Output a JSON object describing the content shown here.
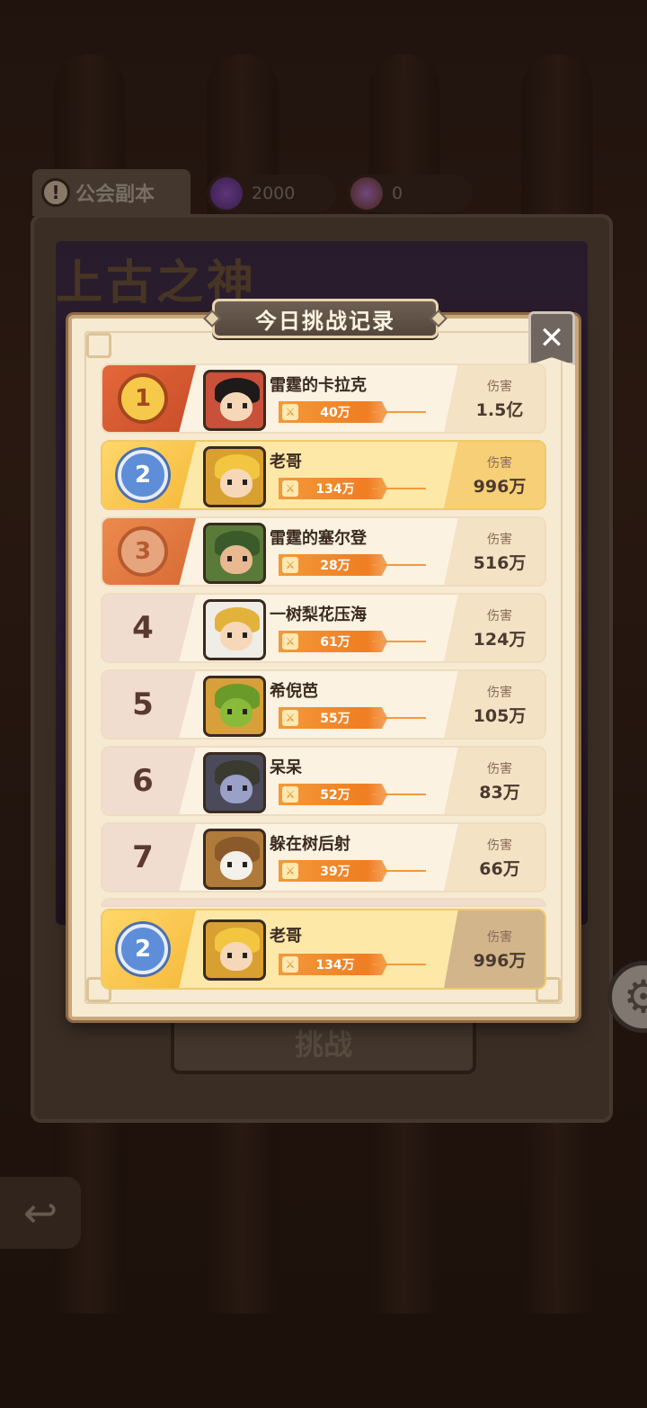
{
  "background": {
    "tab_label": "公会副本",
    "tab_icon": "!",
    "resources": [
      {
        "icon": "purple-gem-coin-icon",
        "value": "2000"
      },
      {
        "icon": "purple-orb-coin-icon",
        "value": "0"
      }
    ],
    "boss_title": "上古之神",
    "challenge_button": "挑战"
  },
  "dialog": {
    "title": "今日挑战记录",
    "close_symbol": "✕",
    "damage_label": "伤害",
    "entries": [
      {
        "rank": "1",
        "name": "雷霆的卡拉克",
        "power": "40万",
        "damage": "1.5亿"
      },
      {
        "rank": "2",
        "name": "老哥",
        "power": "134万",
        "damage": "996万"
      },
      {
        "rank": "3",
        "name": "雷霆的塞尔登",
        "power": "28万",
        "damage": "516万"
      },
      {
        "rank": "4",
        "name": "一树梨花压海",
        "power": "61万",
        "damage": "124万"
      },
      {
        "rank": "5",
        "name": "希倪芭",
        "power": "55万",
        "damage": "105万"
      },
      {
        "rank": "6",
        "name": "呆呆",
        "power": "52万",
        "damage": "83万"
      },
      {
        "rank": "7",
        "name": "躲在树后射",
        "power": "39万",
        "damage": "66万"
      }
    ],
    "my_entry": {
      "rank": "2",
      "name": "老哥",
      "power": "134万",
      "damage": "996万"
    }
  },
  "colors": {
    "rank1": "#e4683a",
    "rank2": "#f5b93a",
    "rank3": "#d86a34",
    "power_bar": "#f07d22",
    "panel_bg": "#f6ead2"
  }
}
